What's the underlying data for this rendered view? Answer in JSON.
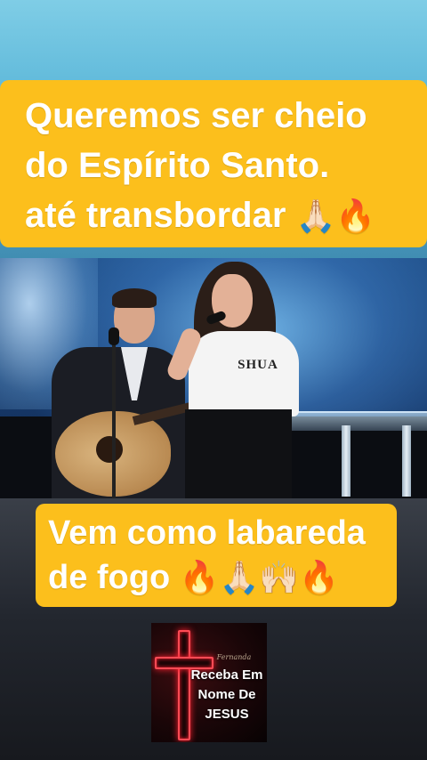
{
  "captions": {
    "top": {
      "lines": [
        "Queremos ser cheio",
        "do Espírito Santo.",
        "até transbordar"
      ],
      "emojis": [
        "🙏🏻",
        "🔥"
      ]
    },
    "middle": {
      "lines": [
        "Vem como labareda",
        "de fogo"
      ],
      "emojis": [
        "🔥",
        "🙏🏻",
        "🙌🏻",
        "🔥"
      ]
    }
  },
  "video": {
    "shirt_text": "SHUA"
  },
  "logo": {
    "script": "Fernanda",
    "lines": [
      "Receba Em",
      "Nome De",
      "JESUS"
    ]
  },
  "colors": {
    "caption_bg": "#fcbf1c",
    "caption_text": "#ffffff",
    "logo_glow": "#ff2030"
  }
}
